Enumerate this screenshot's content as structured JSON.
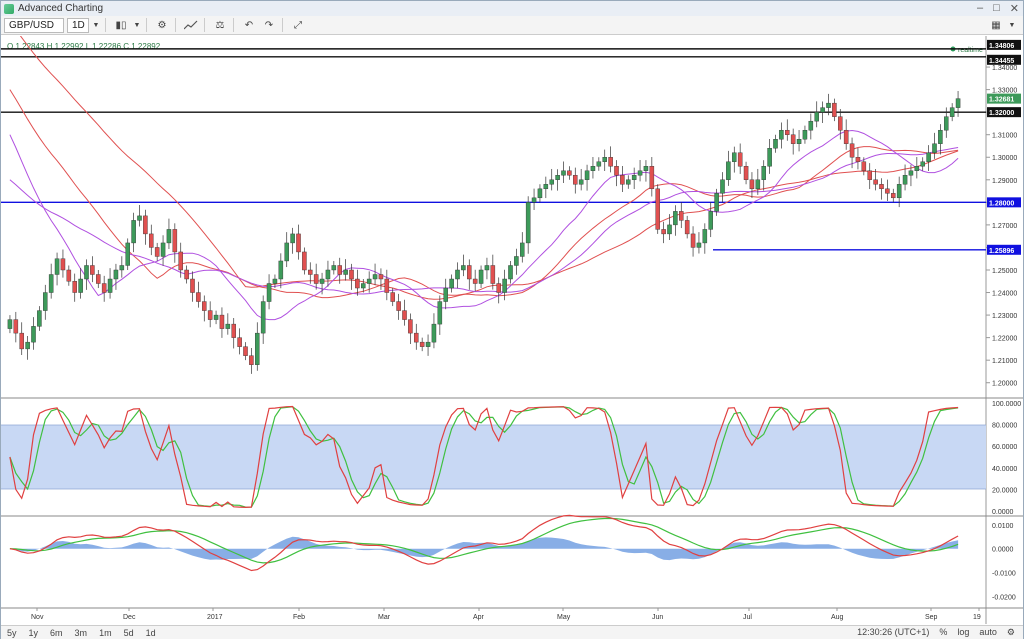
{
  "window": {
    "title": "Advanced Charting",
    "min": "–",
    "max": "□",
    "close": "✕"
  },
  "toolbar": {
    "symbol": "GBP/USD",
    "interval": "1D",
    "dropdown": "▼",
    "candle_icon": "▮▯",
    "settings_icon": "⚙",
    "indicators_icon": "📈",
    "compare_icon": "⚖",
    "undo_icon": "↶",
    "redo_icon": "↷",
    "fullscreen_icon": "⤢",
    "layout_icon": "▦"
  },
  "ohlc_text": "O 1.22843  H 1.22992  L 1.22286  C 1.22892",
  "realtime_label": "realtime",
  "price_axis": [
    "1.34000",
    "1.33000",
    "1.32000",
    "1.31000",
    "1.30000",
    "1.29000",
    "1.28000",
    "1.27000",
    "1.26000",
    "1.25000",
    "1.24000",
    "1.23000",
    "1.22000",
    "1.21000",
    "1.20000"
  ],
  "price_tags": {
    "top1": "1.34806",
    "top2": "1.34455",
    "current": "1.32681",
    "level_1320": "1.32000",
    "level_1280": "1.28000",
    "level_1258": "1.25896"
  },
  "stoch_axis": [
    "100.0000",
    "80.0000",
    "60.0000",
    "40.0000",
    "20.0000",
    "0.0000"
  ],
  "macd_axis": [
    "0.0100",
    "0.0000",
    "-0.0100",
    "-0.0200"
  ],
  "time_axis": [
    "Nov",
    "Dec",
    "2017",
    "Feb",
    "Mar",
    "Apr",
    "May",
    "Jun",
    "Jul",
    "Aug",
    "Sep",
    "19"
  ],
  "timeframes": [
    "5y",
    "1y",
    "6m",
    "3m",
    "1m",
    "5d",
    "1d"
  ],
  "status": {
    "time": "12:30:26 (UTC+1)",
    "percent": "%",
    "log": "log",
    "auto": "auto",
    "settings_icon": "⚙"
  },
  "colors": {
    "up": "#3d9a5a",
    "down": "#e05050",
    "ma_red": "#e05050",
    "ma_purple": "#b050e0",
    "hline_blue": "#1010e0",
    "band": "#c8d8f4"
  },
  "chart_data": {
    "type": "candlestick",
    "symbol": "GBP/USD",
    "ylim": [
      1.195,
      1.352
    ],
    "horizontal_levels": [
      1.34806,
      1.34455,
      1.32,
      1.28,
      1.25896
    ],
    "closes": [
      1.228,
      1.222,
      1.215,
      1.218,
      1.225,
      1.232,
      1.24,
      1.248,
      1.255,
      1.25,
      1.245,
      1.24,
      1.246,
      1.252,
      1.248,
      1.244,
      1.24,
      1.246,
      1.25,
      1.252,
      1.262,
      1.272,
      1.274,
      1.266,
      1.26,
      1.256,
      1.262,
      1.268,
      1.258,
      1.25,
      1.246,
      1.24,
      1.236,
      1.232,
      1.228,
      1.23,
      1.224,
      1.226,
      1.22,
      1.216,
      1.212,
      1.208,
      1.222,
      1.236,
      1.244,
      1.246,
      1.254,
      1.262,
      1.266,
      1.258,
      1.25,
      1.248,
      1.244,
      1.246,
      1.25,
      1.252,
      1.248,
      1.25,
      1.246,
      1.242,
      1.244,
      1.246,
      1.248,
      1.246,
      1.24,
      1.236,
      1.232,
      1.228,
      1.222,
      1.218,
      1.216,
      1.218,
      1.226,
      1.236,
      1.242,
      1.246,
      1.25,
      1.252,
      1.246,
      1.244,
      1.25,
      1.252,
      1.244,
      1.24,
      1.246,
      1.252,
      1.256,
      1.262,
      1.28,
      1.282,
      1.286,
      1.288,
      1.29,
      1.292,
      1.294,
      1.292,
      1.288,
      1.29,
      1.294,
      1.296,
      1.298,
      1.3,
      1.296,
      1.292,
      1.288,
      1.29,
      1.292,
      1.294,
      1.296,
      1.286,
      1.268,
      1.266,
      1.27,
      1.276,
      1.272,
      1.266,
      1.26,
      1.262,
      1.268,
      1.276,
      1.284,
      1.29,
      1.298,
      1.302,
      1.296,
      1.29,
      1.286,
      1.29,
      1.296,
      1.304,
      1.308,
      1.312,
      1.31,
      1.306,
      1.308,
      1.312,
      1.316,
      1.32,
      1.322,
      1.324,
      1.318,
      1.312,
      1.306,
      1.3,
      1.298,
      1.294,
      1.29,
      1.288,
      1.286,
      1.284,
      1.282,
      1.288,
      1.292,
      1.294,
      1.296,
      1.298,
      1.302,
      1.306,
      1.312,
      1.318,
      1.322,
      1.326
    ]
  }
}
